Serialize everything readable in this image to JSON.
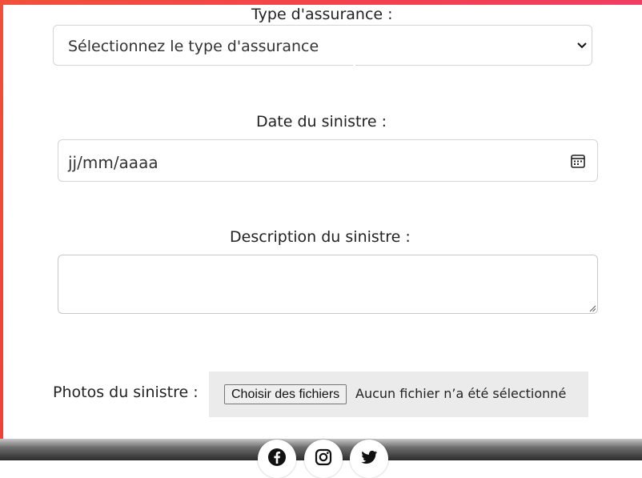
{
  "colors": {
    "accent": "#f2503a",
    "accent_end": "#ef3e63",
    "file_box_bg": "#ebebeb"
  },
  "form": {
    "insurance_type": {
      "label": "Type d'assurance :",
      "selected_value": "Sélectionnez le type d'assurance",
      "icon": "chevron-down-icon"
    },
    "claim_date": {
      "label": "Date du sinistre :",
      "placeholder": "jj/mm/aaaa",
      "icon": "calendar-icon"
    },
    "description": {
      "label": "Description du sinistre :",
      "value": ""
    },
    "photos": {
      "label": "Photos du sinistre :",
      "button_label": "Choisir des fichiers",
      "status_text": "Aucun fichier n’a été sélectionné"
    }
  },
  "footer": {
    "social_icons": [
      "facebook-icon",
      "instagram-icon",
      "twitter-icon"
    ]
  }
}
